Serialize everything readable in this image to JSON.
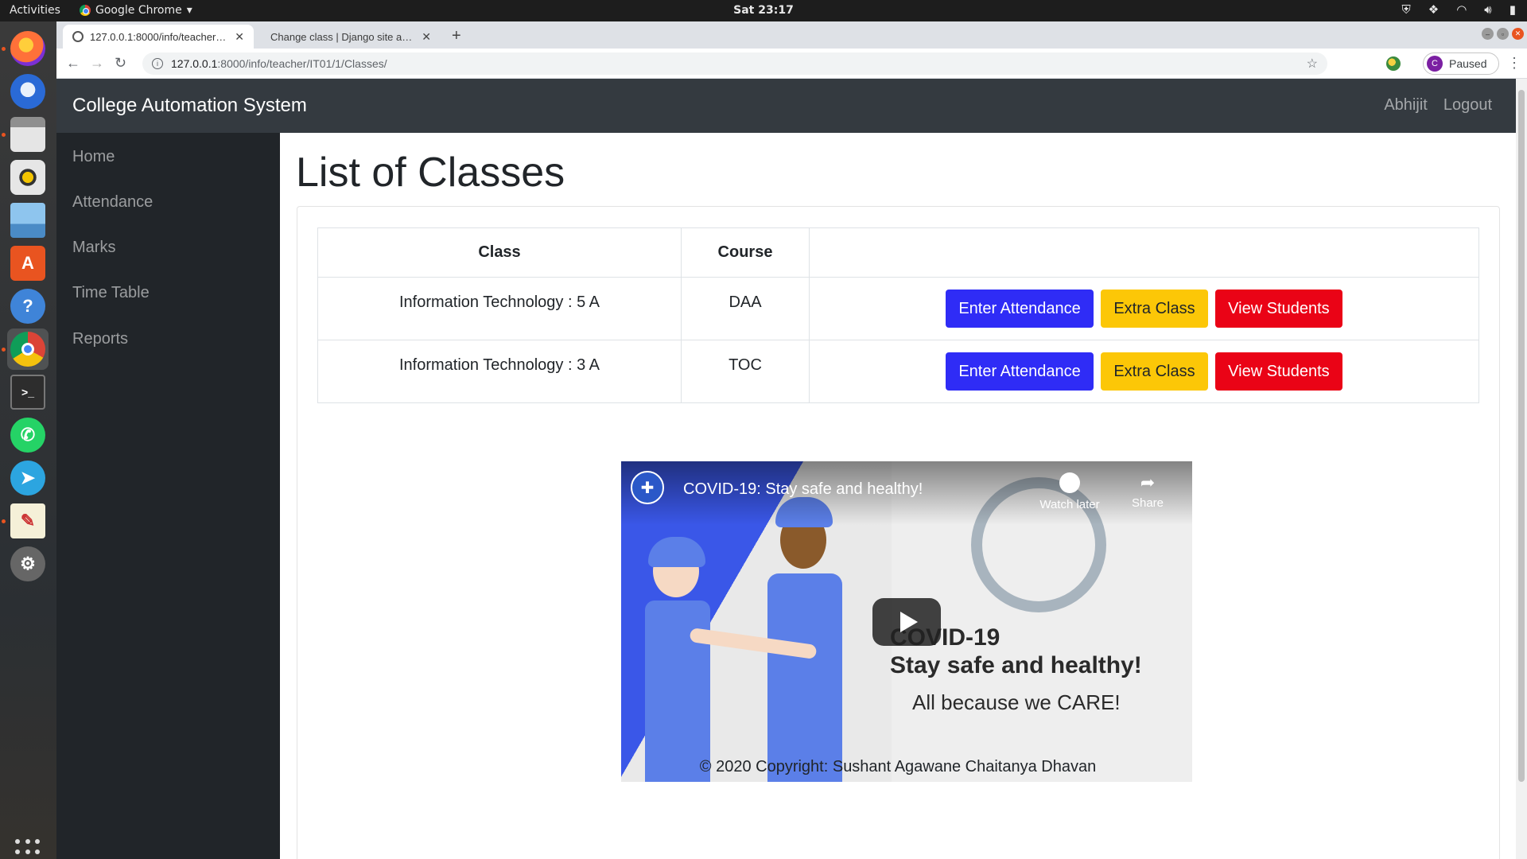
{
  "os": {
    "activities": "Activities",
    "app_menu": "Google Chrome",
    "clock": "Sat 23:17"
  },
  "browser": {
    "tabs": [
      {
        "title": "127.0.0.1:8000/info/teacher/IT01/1/Classes/",
        "active": true
      },
      {
        "title": "Change class | Django site admin",
        "active": false
      }
    ],
    "url_host": "127.0.0.1",
    "url_path": ":8000/info/teacher/IT01/1/Classes/",
    "profile_initial": "C",
    "profile_status": "Paused"
  },
  "navbar": {
    "brand": "College Automation System",
    "user": "Abhijit",
    "logout": "Logout"
  },
  "sidebar": {
    "items": [
      "Home",
      "Attendance",
      "Marks",
      "Time Table",
      "Reports"
    ]
  },
  "page": {
    "title": "List of Classes",
    "columns": [
      "Class",
      "Course",
      ""
    ],
    "rows": [
      {
        "class": "Information Technology : 5 A",
        "course": "DAA"
      },
      {
        "class": "Information Technology : 3 A",
        "course": "TOC"
      }
    ],
    "buttons": {
      "attendance": "Enter Attendance",
      "extra": "Extra Class",
      "view": "View Students"
    },
    "video": {
      "title": "COVID-19: Stay safe and healthy!",
      "watch_later": "Watch later",
      "share": "Share",
      "line1": "COVID-19",
      "line2": "Stay safe and healthy!",
      "line3": "All because we CARE!"
    },
    "copyright": "© 2020 Copyright: Sushant Agawane Chaitanya Dhavan"
  },
  "colors": {
    "btn_attendance": "#2f2cf6",
    "btn_extra": "#fcc707",
    "btn_view": "#ea0316",
    "navbar": "#343a40",
    "sidebar": "#212529"
  }
}
